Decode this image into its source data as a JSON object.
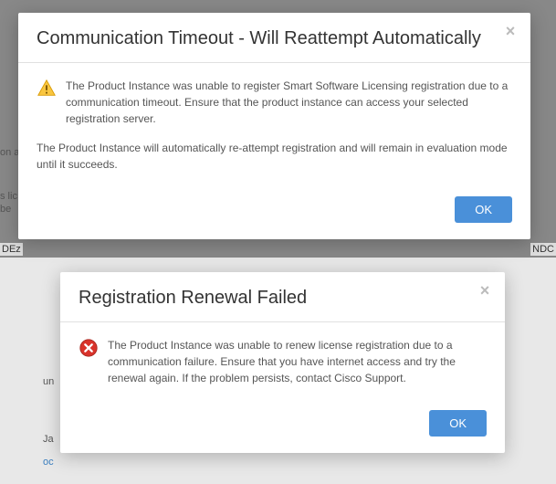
{
  "modal1": {
    "title": "Communication Timeout - Will Reattempt Automatically",
    "message1": "The Product Instance was unable to register Smart Software Licensing registration due to a communication timeout. Ensure that the product instance can access your selected registration server.",
    "message2": "The Product Instance will automatically re-attempt registration and will remain in evaluation mode until it succeeds.",
    "ok": "OK"
  },
  "modal2": {
    "title": "Registration Renewal Failed",
    "message1": "The Product Instance was unable to renew license registration due to a communication failure. Ensure that you have internet access and try the renewal again. If the problem persists, contact Cisco Support.",
    "ok": "OK"
  },
  "bg": {
    "frag1": "on a",
    "frag2": "s lic",
    "frag3": "be",
    "frag4": "DEz",
    "frag5": "NDC",
    "frag6": "un",
    "frag7": "Ja",
    "frag8": "oc"
  },
  "colors": {
    "primary": "#4a90d9"
  }
}
